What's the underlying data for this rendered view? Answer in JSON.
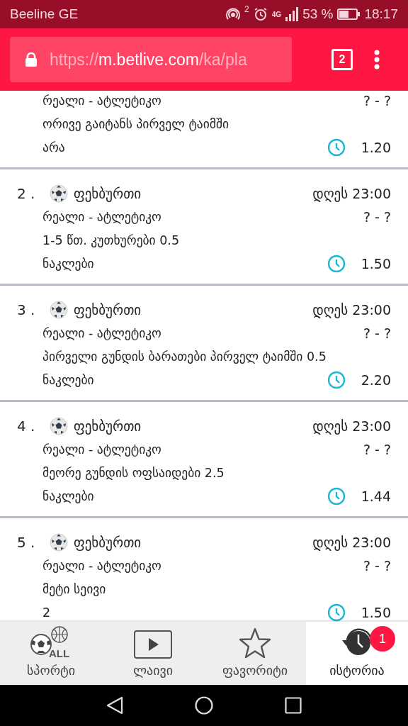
{
  "status_bar": {
    "carrier": "Beeline GE",
    "hotspot_count": "2",
    "network": "4G",
    "battery": "53 %",
    "time": "18:17"
  },
  "browser": {
    "url_scheme": "https://",
    "url_host": "m.betlive.com",
    "url_path": "/ka/pla",
    "tab_count": "2"
  },
  "bets": [
    {
      "teams": "რეალი - ატლეტიკო",
      "score": "? - ?",
      "market": "ორივე გაიტანს პირველ ტაიმში",
      "selection": "არა",
      "odds": "1.20"
    },
    {
      "number": "2 .",
      "sport": "ფეხბურთი",
      "time": "დღეს 23:00",
      "teams": "რეალი - ატლეტიკო",
      "score": "? - ?",
      "market": "1-5 წთ. კუთხურები 0.5",
      "selection": "ნაკლები",
      "odds": "1.50"
    },
    {
      "number": "3 .",
      "sport": "ფეხბურთი",
      "time": "დღეს 23:00",
      "teams": "რეალი - ატლეტიკო",
      "score": "? - ?",
      "market": "პირველი გუნდის ბარათები პირველ ტაიმში 0.5",
      "selection": "ნაკლები",
      "odds": "2.20"
    },
    {
      "number": "4 .",
      "sport": "ფეხბურთი",
      "time": "დღეს 23:00",
      "teams": "რეალი - ატლეტიკო",
      "score": "? - ?",
      "market": "მეორე გუნდის ოფსაიდები 2.5",
      "selection": "ნაკლები",
      "odds": "1.44"
    },
    {
      "number": "5 .",
      "sport": "ფეხბურთი",
      "time": "დღეს 23:00",
      "teams": "რეალი - ატლეტიკო",
      "score": "? - ?",
      "market": "მეტი სეივი",
      "selection": "2",
      "odds": "1.50"
    }
  ],
  "bottom_nav": [
    {
      "kind": "sports",
      "label": "სპორტი",
      "icon_text": "ALL",
      "selected": false
    },
    {
      "kind": "live",
      "label": "ლაივი",
      "selected": false
    },
    {
      "kind": "favorites",
      "label": "ფავორიტი",
      "selected": false
    },
    {
      "kind": "history",
      "label": "ისტორია",
      "badge": "1",
      "selected": true
    }
  ]
}
